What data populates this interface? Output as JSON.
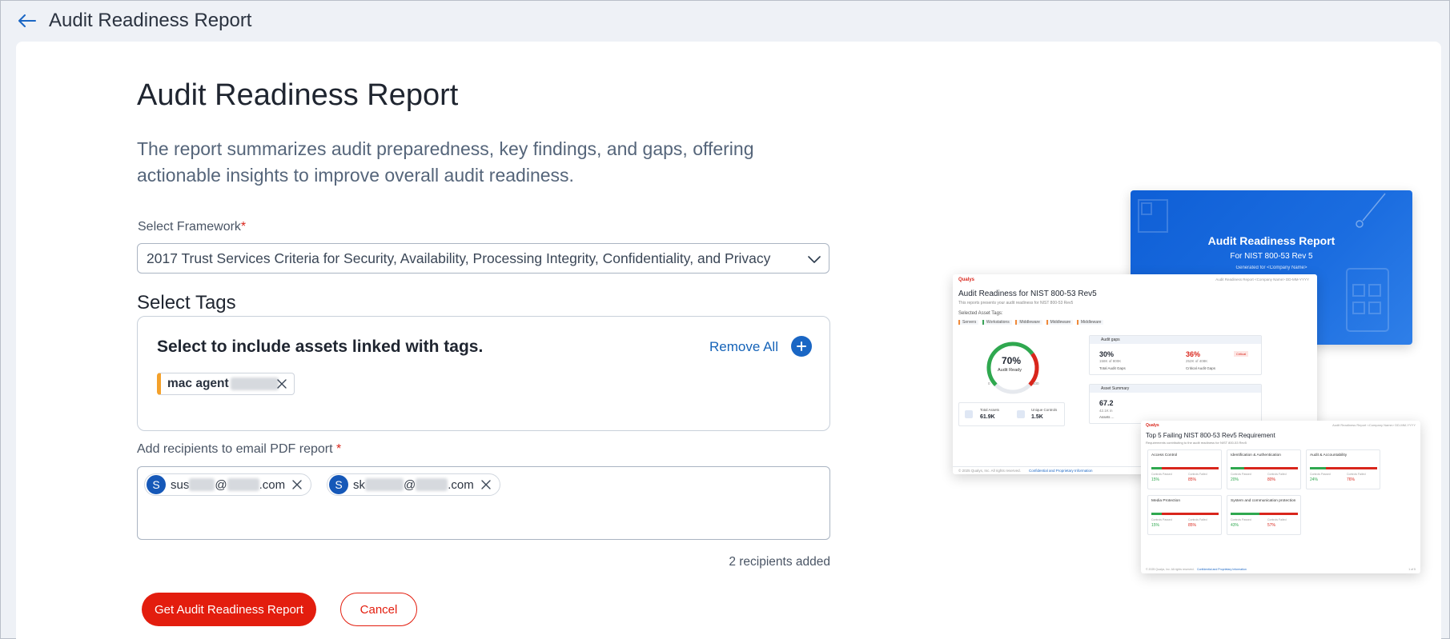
{
  "topbar": {
    "title": "Audit Readiness Report"
  },
  "page": {
    "title": "Audit Readiness Report",
    "description": "The report summarizes audit preparedness, key findings, and gaps, offering actionable insights to improve overall audit readiness."
  },
  "framework": {
    "label": "Select Framework",
    "required_mark": "*",
    "selected": "2017 Trust Services Criteria for Security, Availability, Processing Integrity, Confidentiality, and Privacy"
  },
  "tags": {
    "title": "Select Tags",
    "hint": "Select to include assets linked with tags.",
    "remove_all": "Remove All",
    "items": [
      {
        "label": "mac agent",
        "color": "#f4a12b"
      }
    ]
  },
  "recipients": {
    "label": "Add recipients to email PDF report",
    "required_mark": "*",
    "items": [
      {
        "initial": "S",
        "prefix": "sus",
        "at": "@",
        "suffix": ".com"
      },
      {
        "initial": "S",
        "prefix": "sk",
        "at": "@",
        "suffix": ".com"
      }
    ],
    "count_text": "2 recipients added"
  },
  "actions": {
    "primary": "Get Audit Readiness Report",
    "secondary": "Cancel"
  },
  "preview": {
    "cover": {
      "title": "Audit Readiness Report",
      "subtitle": "For NIST 800-53 Rev 5",
      "generated": "Generated for <Company Name>"
    },
    "page1": {
      "brand": "Qualys",
      "header_right": "Audit Readiness Report  <Company Name>  DD-MM-YYYY",
      "title": "Audit Readiness for NIST 800-53 Rev5",
      "intro": "This reports presents your audit readiness for NIST 800-53 Rev5",
      "selected_tags_label": "Selected Asset Tags:",
      "tags": [
        "Servers",
        "Workstations",
        "Middleware",
        "Middleware",
        "Middleware"
      ],
      "gauge_value": "70%",
      "gauge_label": "Audit Ready",
      "gauge_min": "0",
      "gauge_max": "100",
      "gauge_fraction": 0.7,
      "total_assets_label": "Total Assets",
      "total_assets": "61.9K",
      "unique_controls_label": "Unique Controls",
      "unique_controls": "1.5K",
      "audit_gaps_label": "Audit gaps",
      "gap1_value": "30%",
      "gap1_sub": "158K of 800K",
      "gap1_label": "Total Audit Gaps",
      "gap2_value": "36%",
      "gap2_sub": "252K of 408K",
      "gap2_label": "Critical Audit Gaps",
      "gap2_badge": "Critical",
      "asset_summary_label": "Asset Summary",
      "asset_summary_value": "67.2",
      "asset_summary_sub": "42.1K in",
      "asset_summary_sub2": "Assets ...",
      "footer": "© 2025 Qualys, Inc. All rights reserved.",
      "footer_link": "Confidential and Proprietary Information"
    },
    "page2": {
      "brand": "Qualys",
      "header_right": "Audit Readiness Report  <Company Name>  DD-MM-YYYY",
      "title": "Top 5 Failing NIST 800-53 Rev5 Requirement",
      "intro": "Requirements contributing to the audit readiness for NIST 800-53 Rev5",
      "items": [
        {
          "name": "Access Control",
          "pass": "15%",
          "fail": "85%"
        },
        {
          "name": "Identification & Authentication",
          "pass": "20%",
          "fail": "80%"
        },
        {
          "name": "Audit & Accountability",
          "pass": "24%",
          "fail": "76%"
        },
        {
          "name": "Media Protection",
          "pass": "15%",
          "fail": "85%"
        },
        {
          "name": "System and communication protection",
          "pass": "43%",
          "fail": "57%"
        }
      ],
      "pass_label": "Controls Passed",
      "fail_label": "Controls Failed",
      "footer": "© 2025 Qualys, Inc. All rights reserved.",
      "footer_link": "Confidential and Proprietary Information",
      "page_num": "1 of 5"
    }
  },
  "colors": {
    "accent": "#e31d0e",
    "link": "#1563b8",
    "avatar": "#1658b8"
  }
}
